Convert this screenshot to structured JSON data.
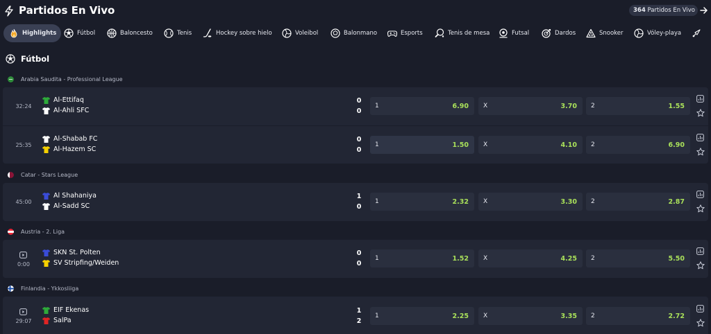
{
  "header": {
    "title": "Partidos En Vivo",
    "live_count": "364",
    "live_label": "Partidos En Vivo"
  },
  "sports": [
    {
      "label": "Highlights",
      "icon": "flame-icon",
      "active": true
    },
    {
      "label": "Fútbol",
      "icon": "soccer-ball-icon"
    },
    {
      "label": "Baloncesto",
      "icon": "basketball-icon"
    },
    {
      "label": "Tenis",
      "icon": "tennis-ball-icon"
    },
    {
      "label": "Hockey sobre hielo",
      "icon": "hockey-stick-icon"
    },
    {
      "label": "Voleibol",
      "icon": "volleyball-icon"
    },
    {
      "label": "Balonmano",
      "icon": "handball-icon"
    },
    {
      "label": "Esports",
      "icon": "gamepad-icon"
    },
    {
      "label": "Tenis de mesa",
      "icon": "ping-pong-icon"
    },
    {
      "label": "Futsal",
      "icon": "futsal-icon"
    },
    {
      "label": "Dardos",
      "icon": "dartboard-icon"
    },
    {
      "label": "Snooker",
      "icon": "snooker-triangle-icon"
    },
    {
      "label": "Vóley-playa",
      "icon": "beach-volleyball-icon"
    }
  ],
  "section": {
    "title": "Fútbol"
  },
  "leagues": [
    {
      "name": "Arabia Saudita - Professional League"
    },
    {
      "name": "Catar - Stars League"
    },
    {
      "name": "Austria - 2. Liga"
    },
    {
      "name": "Finlandia - Ykkosliiga"
    }
  ],
  "matches": [
    {
      "time": "32:24",
      "home": "Al-Ettifaq",
      "away": "Al-Ahli SFC",
      "home_score": "0",
      "away_score": "0",
      "odds": [
        {
          "label": "1",
          "value": "6.90"
        },
        {
          "label": "X",
          "value": "3.70"
        },
        {
          "label": "2",
          "value": "1.55"
        }
      ]
    },
    {
      "time": "25:35",
      "home": "Al-Shabab FC",
      "away": "Al-Hazem SC",
      "home_score": "0",
      "away_score": "0",
      "odds": [
        {
          "label": "1",
          "value": "1.50"
        },
        {
          "label": "X",
          "value": "4.10"
        },
        {
          "label": "2",
          "value": "6.90"
        }
      ]
    },
    {
      "time": "45:00",
      "home": "Al Shahaniya",
      "away": "Al-Sadd SC",
      "home_score": "1",
      "away_score": "0",
      "odds": [
        {
          "label": "1",
          "value": "2.32"
        },
        {
          "label": "X",
          "value": "3.30"
        },
        {
          "label": "2",
          "value": "2.87"
        }
      ]
    },
    {
      "time": "0:00",
      "home": "SKN St. Polten",
      "away": "SV Stripfing/Weiden",
      "home_score": "0",
      "away_score": "0",
      "odds": [
        {
          "label": "1",
          "value": "1.52"
        },
        {
          "label": "X",
          "value": "4.25"
        },
        {
          "label": "2",
          "value": "5.50"
        }
      ]
    },
    {
      "time": "29:07",
      "home": "EIF Ekenas",
      "away": "SalPa",
      "home_score": "1",
      "away_score": "2",
      "odds": [
        {
          "label": "1",
          "value": "2.25"
        },
        {
          "label": "X",
          "value": "3.35"
        },
        {
          "label": "2",
          "value": "2.72"
        }
      ]
    }
  ],
  "colors": {
    "background": "#1a1d29",
    "row": "#222634",
    "odd_button": "#2a2f3e",
    "odd_value": "#a9e05a",
    "jersey_green": "#2eaa3a",
    "jersey_white": "#ffffff",
    "jersey_yellow": "#f5d000",
    "jersey_blue": "#3a4cd8",
    "jersey_red": "#e02424"
  }
}
